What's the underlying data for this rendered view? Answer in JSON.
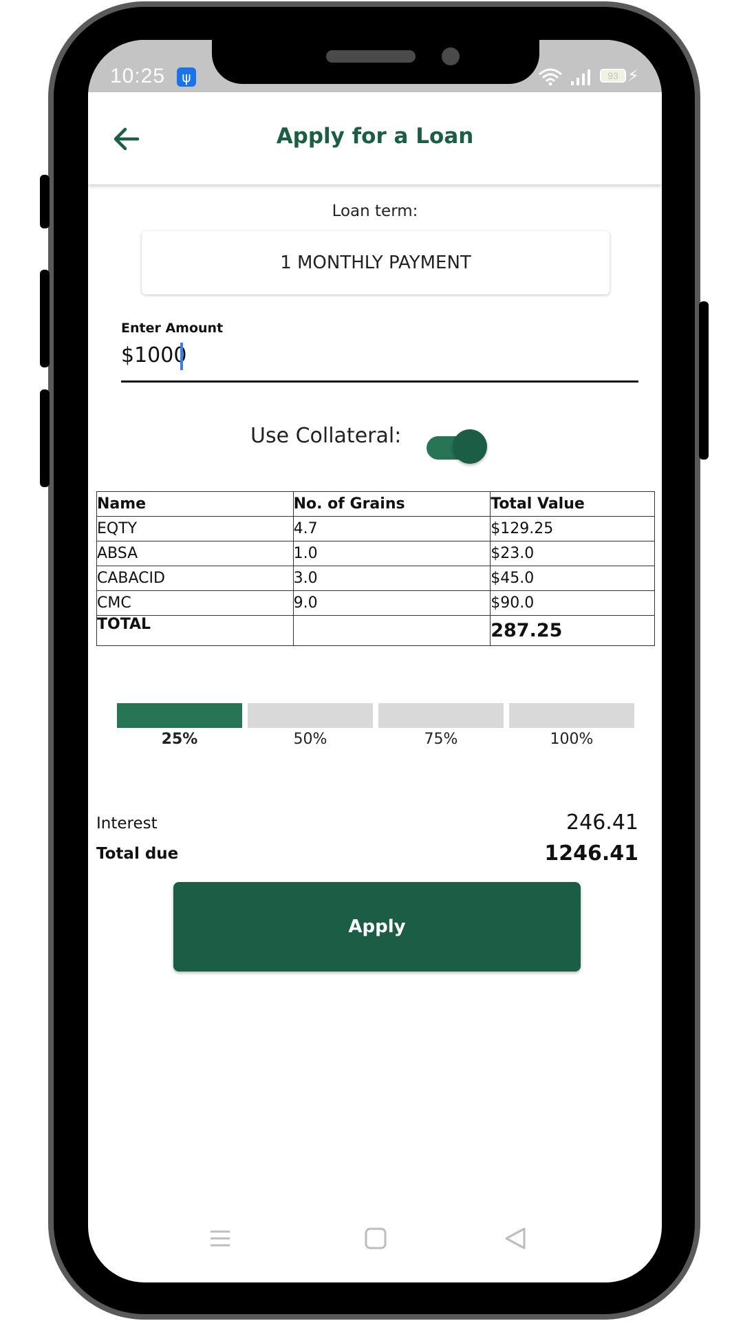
{
  "status": {
    "time": "10:25",
    "battery": "93",
    "icons": [
      "usb-icon",
      "wifi-icon",
      "signal-icon",
      "battery-icon",
      "charging-bolt-icon"
    ]
  },
  "appbar": {
    "title": "Apply for a Loan",
    "back_icon": "arrow-left-icon"
  },
  "loan": {
    "term_label": "Loan term:",
    "term_value": "1 MONTHLY PAYMENT",
    "amount_label": "Enter Amount",
    "amount_value": "$1000",
    "collateral_label": "Use Collateral:",
    "collateral_enabled": true
  },
  "table": {
    "headers": [
      "Name",
      "No. of Grains",
      "Total Value"
    ],
    "rows": [
      [
        "EQTY",
        "4.7",
        "$129.25"
      ],
      [
        "ABSA",
        "1.0",
        "$23.0"
      ],
      [
        "CABACID",
        "3.0",
        "$45.0"
      ],
      [
        "CMC",
        "9.0",
        "$90.0"
      ]
    ],
    "total_label": "TOTAL",
    "total_value": "287.25"
  },
  "percent": {
    "options": [
      "25%",
      "50%",
      "75%",
      "100%"
    ],
    "selected": "25%"
  },
  "summary": {
    "interest_label": "Interest",
    "interest_value": "246.41",
    "total_label": "Total due",
    "total_value": "1246.41"
  },
  "actions": {
    "apply_label": "Apply"
  },
  "colors": {
    "primary": "#1b5e45",
    "accent": "#277554",
    "inactive_segment": "#d9d9d9"
  },
  "navbar": {
    "icons": [
      "menu-icon",
      "home-square-icon",
      "back-triangle-icon"
    ]
  }
}
